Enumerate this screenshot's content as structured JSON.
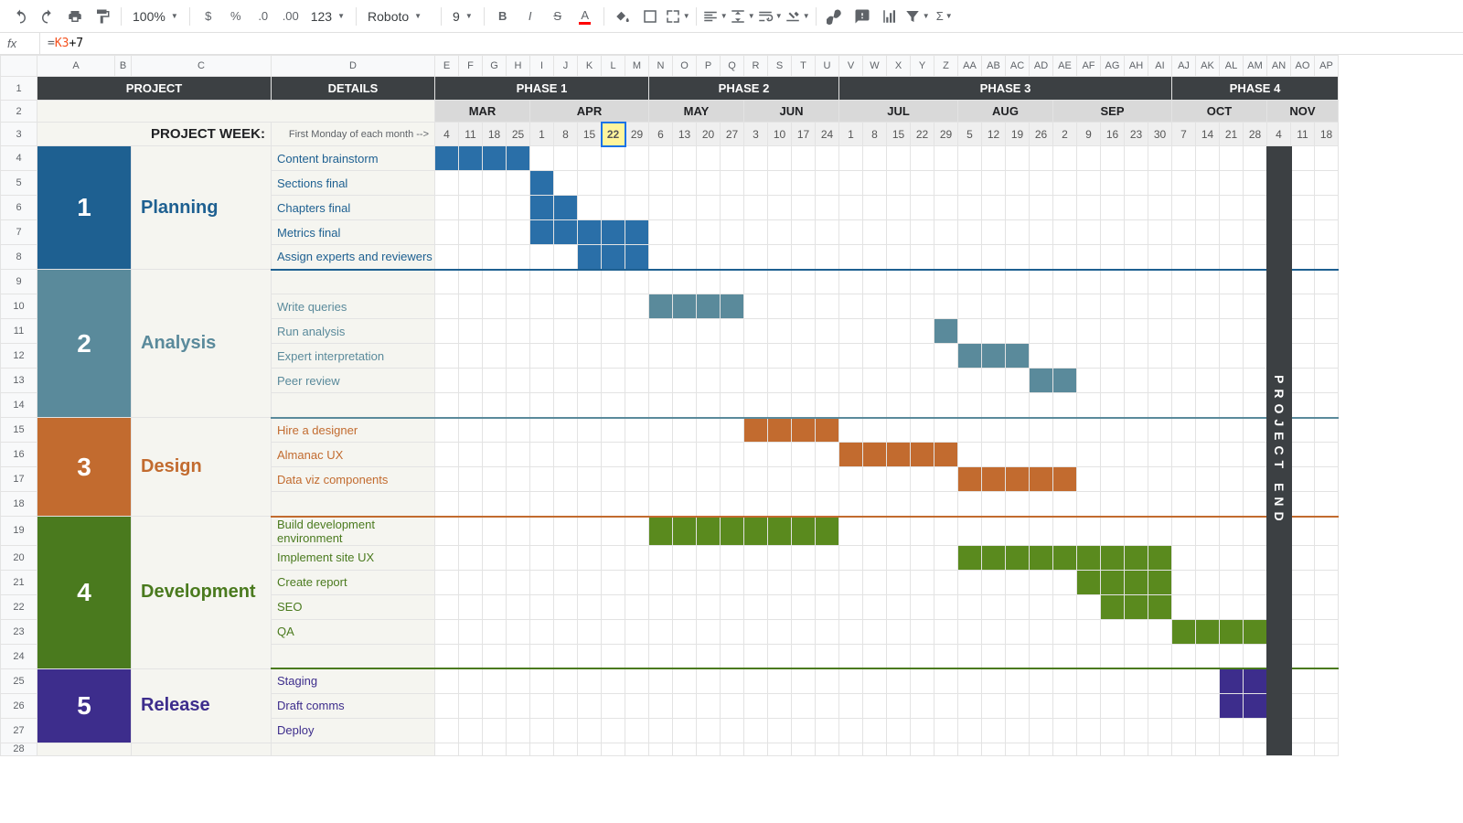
{
  "toolbar": {
    "zoom": "100%",
    "format_num": "123",
    "font": "Roboto",
    "font_size": "9"
  },
  "formula": {
    "ref": "K3",
    "rest": "+7"
  },
  "cols": [
    "A",
    "B",
    "C",
    "D",
    "E",
    "F",
    "G",
    "H",
    "I",
    "J",
    "K",
    "L",
    "M",
    "N",
    "O",
    "P",
    "Q",
    "R",
    "S",
    "T",
    "U",
    "V",
    "W",
    "X",
    "Y",
    "Z",
    "AA",
    "AB",
    "AC",
    "AD",
    "AE",
    "AF",
    "AG",
    "AH",
    "AI",
    "AJ",
    "AK",
    "AL",
    "AM",
    "AN",
    "AO",
    "AP"
  ],
  "headers": {
    "project": "PROJECT",
    "details": "DETAILS",
    "phases": [
      "PHASE 1",
      "PHASE 2",
      "PHASE 3",
      "PHASE 4"
    ],
    "project_week": "PROJECT WEEK:",
    "first_monday": "First Monday of each month -->",
    "months": [
      "MAR",
      "APR",
      "MAY",
      "JUN",
      "JUL",
      "AUG",
      "SEP",
      "OCT",
      "NOV"
    ],
    "weeks": [
      "4",
      "11",
      "18",
      "25",
      "1",
      "8",
      "15",
      "22",
      "29",
      "6",
      "13",
      "20",
      "27",
      "3",
      "10",
      "17",
      "24",
      "1",
      "8",
      "15",
      "22",
      "29",
      "5",
      "12",
      "19",
      "26",
      "2",
      "9",
      "16",
      "23",
      "30",
      "7",
      "14",
      "21",
      "28",
      "4",
      "11",
      "18"
    ],
    "project_end": "PROJECT END"
  },
  "phases": [
    {
      "num": "1",
      "title": "Planning",
      "tasks": [
        "Content brainstorm",
        "Sections final",
        "Chapters final",
        "Metrics final",
        "Assign experts and reviewers"
      ]
    },
    {
      "num": "2",
      "title": "Analysis",
      "tasks": [
        "Write queries",
        "Run analysis",
        "Expert interpretation",
        "Peer review"
      ]
    },
    {
      "num": "3",
      "title": "Design",
      "tasks": [
        "Hire a designer",
        "Almanac UX",
        "Data viz components"
      ]
    },
    {
      "num": "4",
      "title": "Development",
      "tasks": [
        "Build development environment",
        "Implement site UX",
        "Create report",
        "SEO",
        "QA"
      ]
    },
    {
      "num": "5",
      "title": "Release",
      "tasks": [
        "Staging",
        "Draft comms",
        "Deploy"
      ]
    }
  ],
  "chart_data": {
    "type": "gantt",
    "title": "Project Gantt",
    "week_labels": [
      "Mar 4",
      "Mar 11",
      "Mar 18",
      "Mar 25",
      "Apr 1",
      "Apr 8",
      "Apr 15",
      "Apr 22",
      "Apr 29",
      "May 6",
      "May 13",
      "May 20",
      "May 27",
      "Jun 3",
      "Jun 10",
      "Jun 17",
      "Jun 24",
      "Jul 1",
      "Jul 8",
      "Jul 15",
      "Jul 22",
      "Jul 29",
      "Aug 5",
      "Aug 12",
      "Aug 19",
      "Aug 26",
      "Sep 2",
      "Sep 9",
      "Sep 16",
      "Sep 23",
      "Sep 30",
      "Oct 7",
      "Oct 14",
      "Oct 21",
      "Oct 28",
      "Nov 4",
      "Nov 11",
      "Nov 18"
    ],
    "tasks": [
      {
        "phase": "Planning",
        "name": "Content brainstorm",
        "start": 0,
        "end": 3
      },
      {
        "phase": "Planning",
        "name": "Sections final",
        "start": 4,
        "end": 4
      },
      {
        "phase": "Planning",
        "name": "Chapters final",
        "start": 4,
        "end": 5
      },
      {
        "phase": "Planning",
        "name": "Metrics final",
        "start": 4,
        "end": 8
      },
      {
        "phase": "Planning",
        "name": "Assign experts and reviewers",
        "start": 6,
        "end": 8
      },
      {
        "phase": "Analysis",
        "name": "Write queries",
        "start": 9,
        "end": 12
      },
      {
        "phase": "Analysis",
        "name": "Run analysis",
        "start": 21,
        "end": 21
      },
      {
        "phase": "Analysis",
        "name": "Expert interpretation",
        "start": 22,
        "end": 24
      },
      {
        "phase": "Analysis",
        "name": "Peer review",
        "start": 25,
        "end": 26
      },
      {
        "phase": "Design",
        "name": "Hire a designer",
        "start": 13,
        "end": 16
      },
      {
        "phase": "Design",
        "name": "Almanac UX",
        "start": 17,
        "end": 21
      },
      {
        "phase": "Design",
        "name": "Data viz components",
        "start": 22,
        "end": 26
      },
      {
        "phase": "Development",
        "name": "Build development environment",
        "start": 9,
        "end": 16
      },
      {
        "phase": "Development",
        "name": "Implement site UX",
        "start": 22,
        "end": 30
      },
      {
        "phase": "Development",
        "name": "Create report",
        "start": 27,
        "end": 30
      },
      {
        "phase": "Development",
        "name": "SEO",
        "start": 28,
        "end": 30
      },
      {
        "phase": "Development",
        "name": "QA",
        "start": 31,
        "end": 34
      },
      {
        "phase": "Release",
        "name": "Staging",
        "start": 33,
        "end": 34
      },
      {
        "phase": "Release",
        "name": "Draft comms",
        "start": 33,
        "end": 35
      },
      {
        "phase": "Release",
        "name": "Deploy",
        "start": 35,
        "end": 35
      }
    ]
  }
}
